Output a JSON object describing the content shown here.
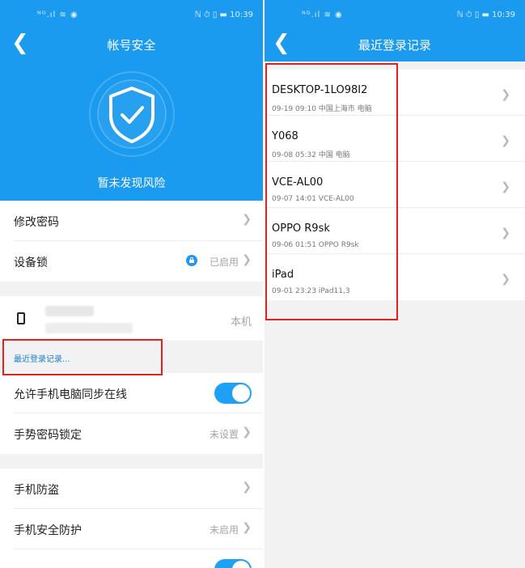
{
  "status_bar": {
    "left": "ᴺᴳ.ıl ≋ ◉",
    "time": "10:39",
    "icons": "ℕ ⏱ ▯ ▬"
  },
  "left": {
    "title": "帐号安全",
    "risk_text": "暂未发现风险",
    "change_password": "修改密码",
    "device_lock": {
      "label": "设备锁",
      "value": "已启用"
    },
    "this_device": "本机",
    "recent_login_link": "最近登录记录...",
    "sync_online": "允许手机电脑同步在线",
    "gesture_lock": {
      "label": "手势密码锁定",
      "value": "未设置"
    },
    "anti_theft": "手机防盗",
    "security": {
      "label": "手机安全防护",
      "value": "未启用"
    }
  },
  "right": {
    "title": "最近登录记录",
    "records": [
      {
        "name": "DESKTOP-1LO98I2",
        "meta": "09-19  09:10 中国上海市 电脑"
      },
      {
        "name": "Y068",
        "meta": "09-08  05:32 中国 电脑"
      },
      {
        "name": "VCE-AL00",
        "meta": "09-07  14:01 VCE-AL00"
      },
      {
        "name": "OPPO R9sk",
        "meta": "09-06  01:51 OPPO R9sk"
      },
      {
        "name": "iPad",
        "meta": "09-01  23:23 iPad11,3"
      }
    ]
  },
  "colors": {
    "accent": "#1a9bf0",
    "highlight": "#e12020"
  },
  "icons": [
    "back-arrow-icon",
    "shield-check-icon",
    "chevron-right-icon",
    "lock-icon",
    "phone-icon"
  ]
}
